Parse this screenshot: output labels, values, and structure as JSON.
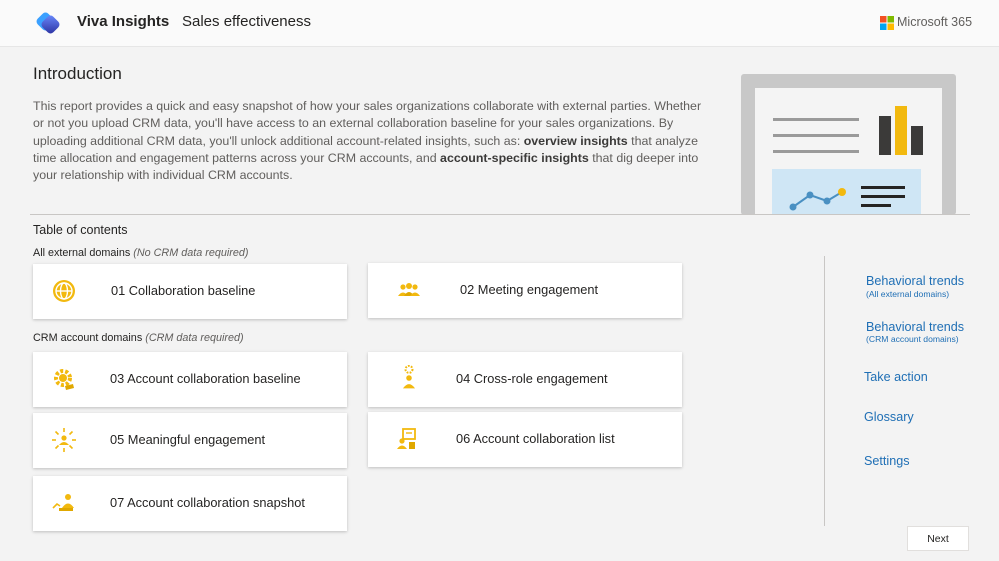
{
  "header": {
    "app_name": "Viva Insights",
    "report_name": "Sales effectiveness",
    "brand": "Microsoft 365",
    "logo_icon": "viva-insights-logo",
    "brand_icon": "microsoft-logo"
  },
  "intro": {
    "title": "Introduction",
    "text_1": "This report provides a quick and easy snapshot of how your sales organizations collaborate with external parties. Whether or not you upload CRM data, you'll have access to an external collaboration baseline for your sales organizations. By uploading additional CRM data, you'll unlock additional account-related insights, such as: ",
    "bold_1": "overview insights",
    "text_2": " that analyze time allocation and engagement patterns across your CRM accounts, and ",
    "bold_2": "account-specific insights",
    "text_3": " that dig deeper into your relationship with individual CRM accounts."
  },
  "toc": {
    "title": "Table of contents",
    "group_1": {
      "label": "All external domains",
      "note": "(No CRM data required)"
    },
    "group_2": {
      "label": "CRM account domains",
      "note": "(CRM data required)"
    },
    "cards": [
      {
        "label": "01 Collaboration baseline",
        "icon": "globe-icon"
      },
      {
        "label": "02 Meeting engagement",
        "icon": "people-group-icon"
      },
      {
        "label": "03 Account collaboration baseline",
        "icon": "gear-hand-icon"
      },
      {
        "label": "04 Cross-role engagement",
        "icon": "person-gear-icon"
      },
      {
        "label": "05 Meaningful engagement",
        "icon": "sparkle-person-icon"
      },
      {
        "label": "06 Account collaboration list",
        "icon": "person-board-icon"
      },
      {
        "label": "07 Account collaboration snapshot",
        "icon": "person-chart-icon"
      }
    ]
  },
  "sidebar": {
    "items": [
      {
        "label": "Behavioral trends",
        "sub": "(All external domains)"
      },
      {
        "label": "Behavioral trends",
        "sub": "(CRM account domains)"
      },
      {
        "label": "Take action"
      },
      {
        "label": "Glossary"
      },
      {
        "label": "Settings"
      }
    ]
  },
  "footer": {
    "next_label": "Next"
  },
  "colors": {
    "accent": "#1f6fb5",
    "icon_gold": "#f2b90f",
    "brand_purple": "#3a3dbd"
  }
}
